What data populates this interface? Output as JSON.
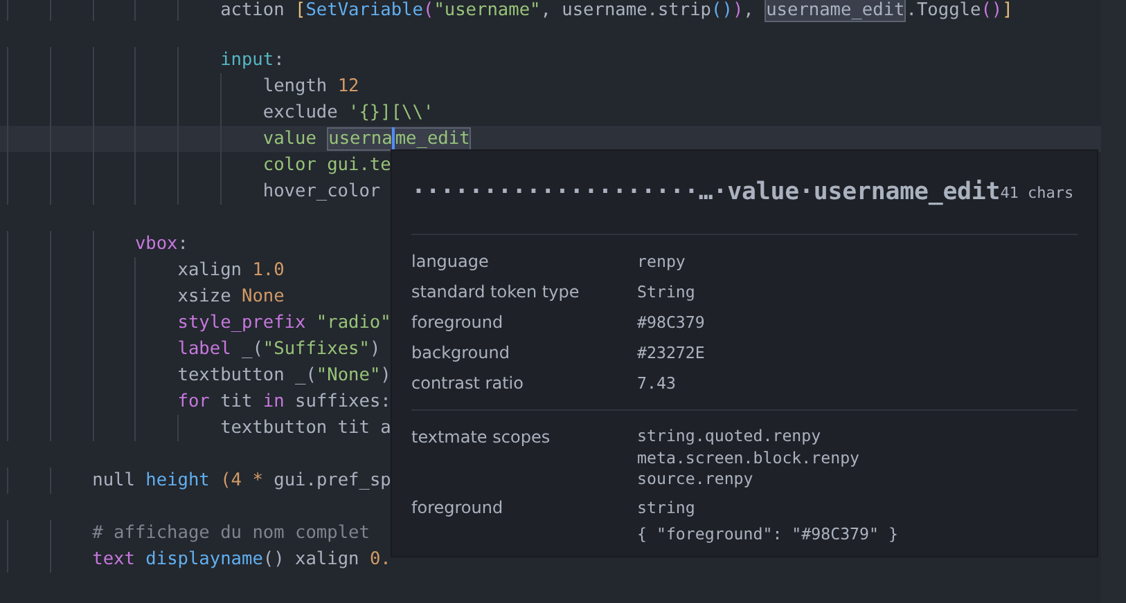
{
  "editor": {
    "lines": [
      {
        "current": false,
        "tokens": [
          {
            "text": "                    action ",
            "kind": "plain"
          },
          {
            "text": "[",
            "kind": "bracket1"
          },
          {
            "text": "SetVariable",
            "kind": "function"
          },
          {
            "text": "(",
            "kind": "bracket2"
          },
          {
            "text": "\"username\"",
            "kind": "string"
          },
          {
            "text": ", username.strip",
            "kind": "plain"
          },
          {
            "text": "()",
            "kind": "bracket3"
          },
          {
            "text": ")",
            "kind": "bracket2"
          },
          {
            "text": ", ",
            "kind": "plain"
          },
          {
            "text": "username_edit",
            "kind": "match"
          },
          {
            "text": ".Toggle",
            "kind": "plain"
          },
          {
            "text": "()",
            "kind": "bracket2"
          },
          {
            "text": "]",
            "kind": "bracket1"
          }
        ]
      },
      {
        "current": false
      },
      {
        "current": false,
        "tokens": [
          {
            "text": "                    input",
            "kind": "property"
          },
          {
            "text": ":",
            "kind": "plain"
          }
        ]
      },
      {
        "current": false,
        "tokens": [
          {
            "text": "                        length ",
            "kind": "plain"
          },
          {
            "text": "12",
            "kind": "number"
          }
        ]
      },
      {
        "current": false,
        "tokens": [
          {
            "text": "                        exclude ",
            "kind": "plain"
          },
          {
            "text": "'{}][\\\\'",
            "kind": "string"
          }
        ]
      },
      {
        "current": true,
        "tokens": [
          {
            "text": "                        value ",
            "kind": "string"
          },
          {
            "text": "userna",
            "kind": "matchopen"
          },
          {
            "kind": "caret"
          },
          {
            "text": "me_edit",
            "kind": "matchclose"
          }
        ]
      },
      {
        "current": false,
        "tokens": [
          {
            "text": "                        color gui.te",
            "kind": "string"
          }
        ]
      },
      {
        "current": false,
        "tokens": [
          {
            "text": "                        hover_color",
            "kind": "plain"
          }
        ]
      },
      {
        "current": false
      },
      {
        "current": false,
        "tokens": [
          {
            "text": "            vbox",
            "kind": "keyword"
          },
          {
            "text": ":",
            "kind": "plain"
          }
        ]
      },
      {
        "current": false,
        "tokens": [
          {
            "text": "                xalign ",
            "kind": "plain"
          },
          {
            "text": "1.0",
            "kind": "number"
          }
        ]
      },
      {
        "current": false,
        "tokens": [
          {
            "text": "                xsize ",
            "kind": "plain"
          },
          {
            "text": "None",
            "kind": "number"
          }
        ]
      },
      {
        "current": false,
        "tokens": [
          {
            "text": "                style_prefix",
            "kind": "keyword"
          },
          {
            "text": " \"radio\"",
            "kind": "string"
          }
        ]
      },
      {
        "current": false,
        "tokens": [
          {
            "text": "                label",
            "kind": "keyword"
          },
          {
            "text": " _(",
            "kind": "plain"
          },
          {
            "text": "\"Suffixes\"",
            "kind": "string"
          },
          {
            "text": ")",
            "kind": "plain"
          }
        ]
      },
      {
        "current": false,
        "tokens": [
          {
            "text": "                textbutton _(",
            "kind": "plain"
          },
          {
            "text": "\"None\"",
            "kind": "string"
          },
          {
            "text": ")",
            "kind": "plain"
          }
        ]
      },
      {
        "current": false,
        "tokens": [
          {
            "text": "                for",
            "kind": "keyword"
          },
          {
            "text": " tit ",
            "kind": "plain"
          },
          {
            "text": "in",
            "kind": "keyword"
          },
          {
            "text": " suffixes:",
            "kind": "plain"
          }
        ]
      },
      {
        "current": false,
        "tokens": [
          {
            "text": "                    textbutton tit a",
            "kind": "plain"
          }
        ]
      },
      {
        "current": false
      },
      {
        "current": false,
        "tokens": [
          {
            "text": "        null ",
            "kind": "plain"
          },
          {
            "text": "height",
            "kind": "function"
          },
          {
            "text": " (4 * ",
            "kind": "number"
          },
          {
            "text": "gui.pref_sp",
            "kind": "plain"
          }
        ]
      },
      {
        "current": false
      },
      {
        "current": false,
        "tokens": [
          {
            "text": "        # affichage du nom complet",
            "kind": "comment"
          }
        ]
      },
      {
        "current": false,
        "tokens": [
          {
            "text": "        text ",
            "kind": "keyword"
          },
          {
            "text": "displayname",
            "kind": "function"
          },
          {
            "text": "() xalign ",
            "kind": "plain"
          },
          {
            "text": "0.",
            "kind": "number"
          }
        ]
      }
    ]
  },
  "hover": {
    "title": "····················…·value·username_edit",
    "length": "41 chars",
    "sections": [
      {
        "rows": [
          {
            "label": "language",
            "values": [
              "renpy"
            ]
          },
          {
            "label": "standard token type",
            "values": [
              "String"
            ]
          },
          {
            "label": "foreground",
            "values": [
              "#98C379"
            ]
          },
          {
            "label": "background",
            "values": [
              "#23272E"
            ]
          },
          {
            "label": "contrast ratio",
            "values": [
              "7.43"
            ]
          }
        ]
      },
      {
        "rows": [
          {
            "label": "textmate scopes",
            "values": [
              "string.quoted.renpy",
              "meta.screen.block.renpy",
              "source.renpy"
            ]
          },
          {
            "label": "foreground",
            "values": [
              "string",
              "{ \"foreground\": \"#98C379\" }"
            ]
          }
        ]
      }
    ]
  }
}
